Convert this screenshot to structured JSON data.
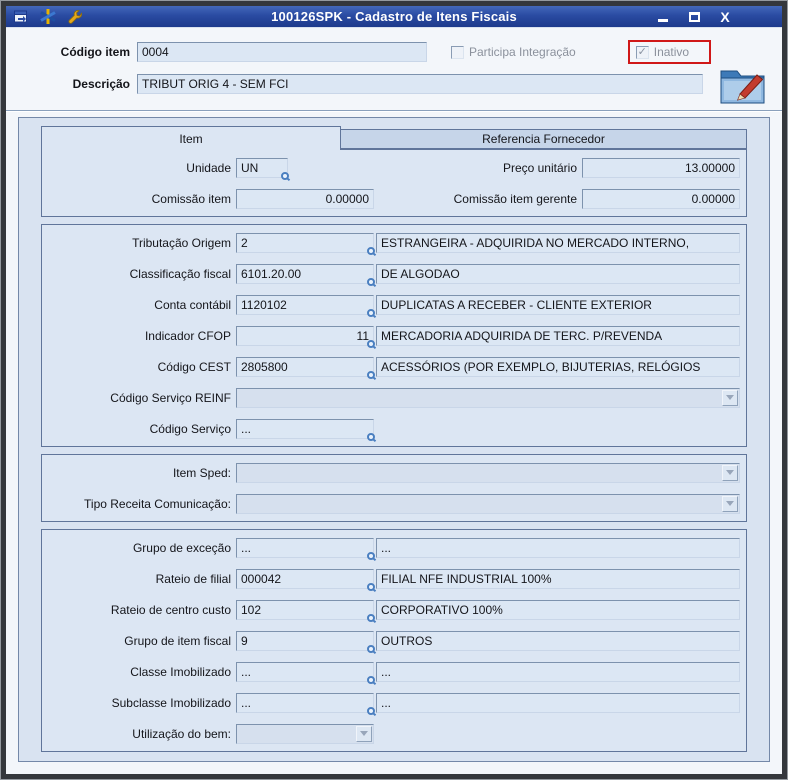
{
  "colors": {
    "titlebar": "#27479c",
    "annotation_red": "#d01818",
    "field_bg": "#dce7f4",
    "panel_bg": "#d9e3f1",
    "group_border": "#60759a"
  },
  "window": {
    "title": "100126SPK - Cadastro de Itens Fiscais",
    "close_glyph": "X"
  },
  "header": {
    "codigo_label": "Código item",
    "codigo_value": "0004",
    "participa_label": "Participa Integração",
    "inativo_label": "Inativo",
    "inativo_check": "✓",
    "descricao_label": "Descrição",
    "descricao_value": "TRIBUT ORIG 4 - SEM FCI"
  },
  "tabs": {
    "item": "Item",
    "referencia": "Referencia Fornecedor"
  },
  "item_tab": {
    "unidade_label": "Unidade",
    "unidade_value": "UN",
    "preco_label": "Preço unitário",
    "preco_value": "13.00000",
    "comissao_label": "Comissão item",
    "comissao_value": "0.00000",
    "comissao_gerente_label": "Comissão item gerente",
    "comissao_gerente_value": "0.00000",
    "tributacao_label": "Tributação Origem",
    "tributacao_code": "2",
    "tributacao_desc": "ESTRANGEIRA - ADQUIRIDA NO MERCADO INTERNO,",
    "classificacao_label": "Classificação fiscal",
    "classificacao_code": "6101.20.00",
    "classificacao_desc": "DE ALGODAO",
    "conta_label": "Conta contábil",
    "conta_code": "1120102",
    "conta_desc": "DUPLICATAS A RECEBER - CLIENTE EXTERIOR",
    "cfop_label": "Indicador CFOP",
    "cfop_code": "11",
    "cfop_desc": "MERCADORIA ADQUIRIDA DE TERC. P/REVENDA",
    "cest_label": "Código CEST",
    "cest_code": "2805800",
    "cest_desc": "ACESSÓRIOS (POR EXEMPLO, BIJUTERIAS, RELÓGIOS",
    "reinf_label": "Código Serviço REINF",
    "servico_label": "Código Serviço",
    "servico_code": "...",
    "sped_label": "Item Sped:",
    "receita_label": "Tipo Receita Comunicação:",
    "excecao_label": "Grupo de exceção",
    "excecao_code": "...",
    "excecao_desc": "...",
    "rateio_filial_label": "Rateio de filial",
    "rateio_filial_code": "000042",
    "rateio_filial_desc": "FILIAL NFE INDUSTRIAL 100%",
    "rateio_custo_label": "Rateio de centro custo",
    "rateio_custo_code": "102",
    "rateio_custo_desc": "CORPORATIVO 100%",
    "grupo_fiscal_label": "Grupo de item fiscal",
    "grupo_fiscal_code": "9",
    "grupo_fiscal_desc": "OUTROS",
    "classe_label": "Classe Imobilizado",
    "classe_code": "...",
    "classe_desc": "...",
    "subclasse_label": "Subclasse Imobilizado",
    "subclasse_code": "...",
    "subclasse_desc": "...",
    "utilizacao_label": "Utilização do bem:"
  }
}
